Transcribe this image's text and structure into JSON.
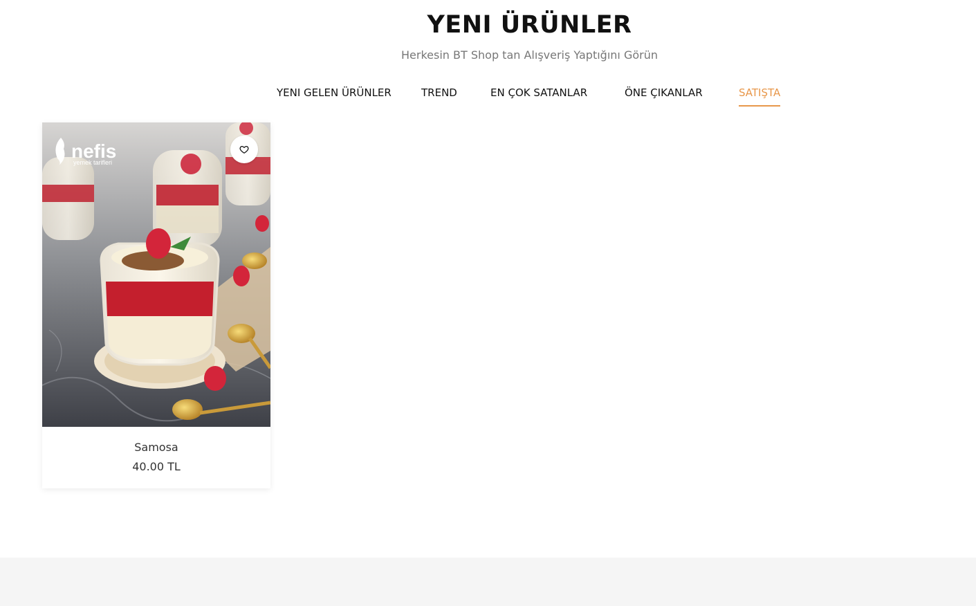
{
  "section": {
    "title": "YENI ÜRÜNLER",
    "subtitle": "Herkesin BT Shop tan Alışveriş Yaptığını Görün"
  },
  "tabs": [
    {
      "label": "YENI GELEN ÜRÜNLER",
      "active": false
    },
    {
      "label": "TREND",
      "active": false
    },
    {
      "label": "EN ÇOK SATANLAR",
      "active": false
    },
    {
      "label": "ÖNE ÇIKANLAR",
      "active": false
    },
    {
      "label": "SATIŞTA",
      "active": true
    }
  ],
  "products": [
    {
      "name": "Samosa",
      "price": "40.00 TL",
      "image_watermark": "nefis yemek tarifleri",
      "wishlist_icon": "heart-outline-icon"
    }
  ],
  "colors": {
    "accent": "#e8974a",
    "text": "#111111",
    "subtitle": "#777777",
    "footer_bg": "#f5f5f5"
  }
}
